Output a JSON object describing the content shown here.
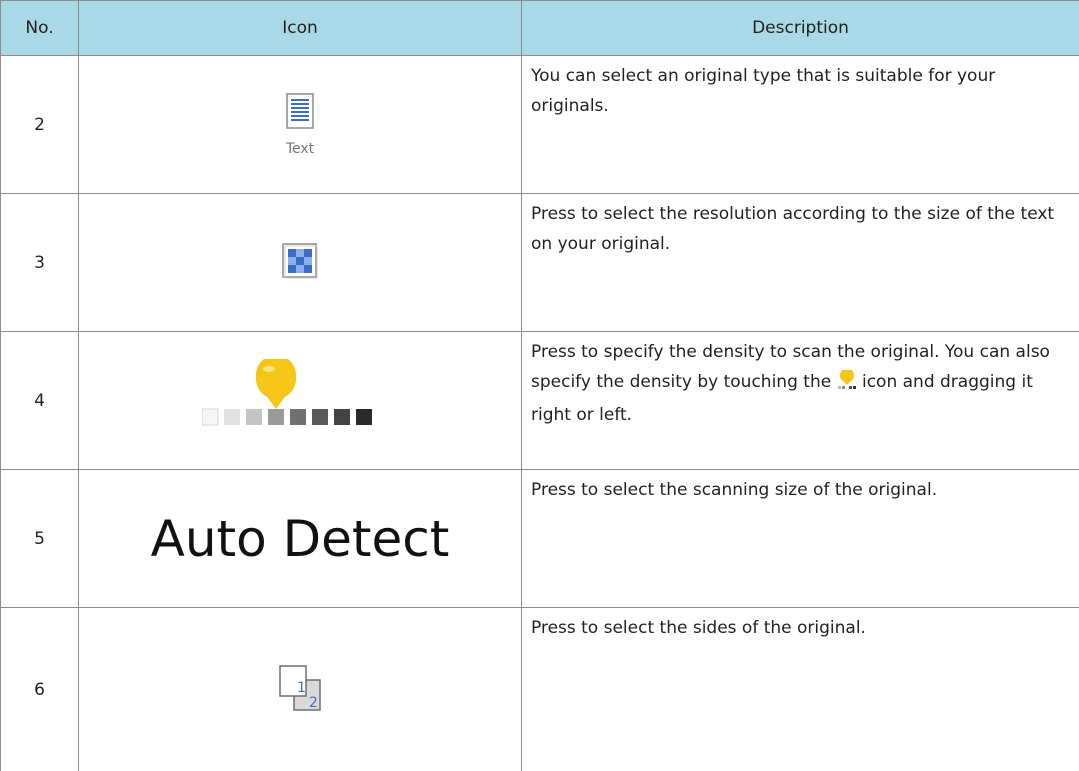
{
  "table": {
    "headers": {
      "no": "No.",
      "icon": "Icon",
      "description": "Description"
    },
    "rows": [
      {
        "no": "2",
        "icon_name": "original-type-text-icon",
        "icon_label": "Text",
        "description": "You can select an original type that is suitable for your originals."
      },
      {
        "no": "3",
        "icon_name": "resolution-icon",
        "description": "Press to select the resolution according to the size of the text on your original."
      },
      {
        "no": "4",
        "icon_name": "density-slider-icon",
        "description_part1": "Press to specify the density to scan the original. You can also specify the density by touching the ",
        "description_part2": " icon and dragging it right or left."
      },
      {
        "no": "5",
        "icon_name": "auto-detect-label",
        "icon_text": "Auto Detect",
        "description": "Press to select the scanning size of the original."
      },
      {
        "no": "6",
        "icon_name": "sides-icon",
        "icon_digits": [
          "1",
          "2"
        ],
        "description": "Press to select the sides of the original."
      }
    ]
  },
  "colors": {
    "header_bg": "#a9d8e6",
    "icon_blue": "#3b6fc7",
    "pin_yellow": "#f5c518",
    "border": "#8c8c8c"
  }
}
